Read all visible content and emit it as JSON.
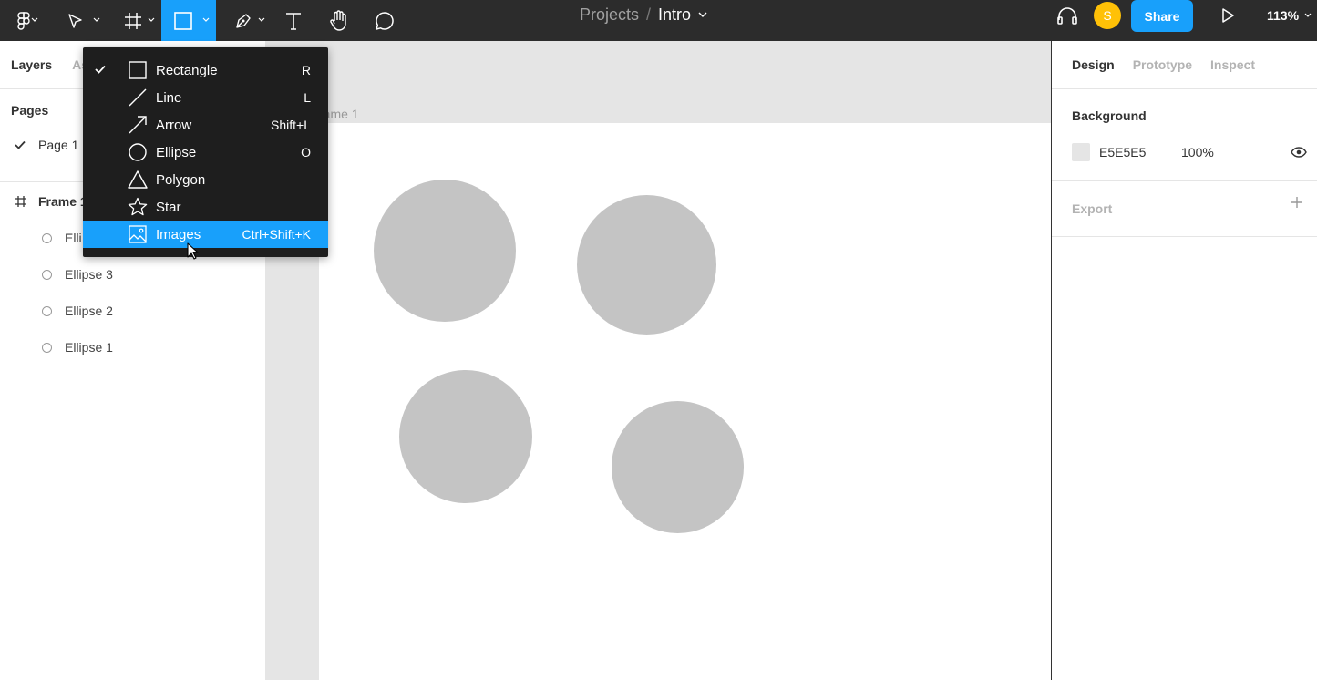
{
  "toolbar": {
    "project": "Projects",
    "separator": "/",
    "file_name": "Intro",
    "avatar_initial": "S",
    "share_label": "Share",
    "zoom": "113%",
    "accent_color": "#18a0fb"
  },
  "left_panel": {
    "tabs": [
      "Layers",
      "As"
    ],
    "pages_heading": "Pages",
    "pages": [
      {
        "label": "Page 1",
        "selected": true
      }
    ],
    "frame_label": "Frame 1",
    "layers": [
      "Ellipse 4",
      "Ellipse 3",
      "Ellipse 2",
      "Ellipse 1"
    ],
    "layer_visible_text": [
      "Elli",
      "Ellipse 3",
      "Ellipse 2",
      "Ellipse 1"
    ]
  },
  "canvas": {
    "frame_title": "rame 1",
    "ellipse_color": "#c4c4c4",
    "frame_bg": "#ffffff",
    "canvas_bg": "#e5e5e5"
  },
  "shape_menu": {
    "items": [
      {
        "label": "Rectangle",
        "shortcut": "R",
        "icon": "rectangle-icon",
        "checked": true
      },
      {
        "label": "Line",
        "shortcut": "L",
        "icon": "line-icon"
      },
      {
        "label": "Arrow",
        "shortcut": "Shift+L",
        "icon": "arrow-icon"
      },
      {
        "label": "Ellipse",
        "shortcut": "O",
        "icon": "ellipse-icon"
      },
      {
        "label": "Polygon",
        "shortcut": "",
        "icon": "polygon-icon"
      },
      {
        "label": "Star",
        "shortcut": "",
        "icon": "star-icon"
      },
      {
        "label": "Images",
        "shortcut": "Ctrl+Shift+K",
        "icon": "image-icon",
        "highlighted": true
      }
    ]
  },
  "right_panel": {
    "tabs": [
      "Design",
      "Prototype",
      "Inspect"
    ],
    "background_heading": "Background",
    "background_hex": "E5E5E5",
    "background_opacity": "100%",
    "export_heading": "Export"
  }
}
